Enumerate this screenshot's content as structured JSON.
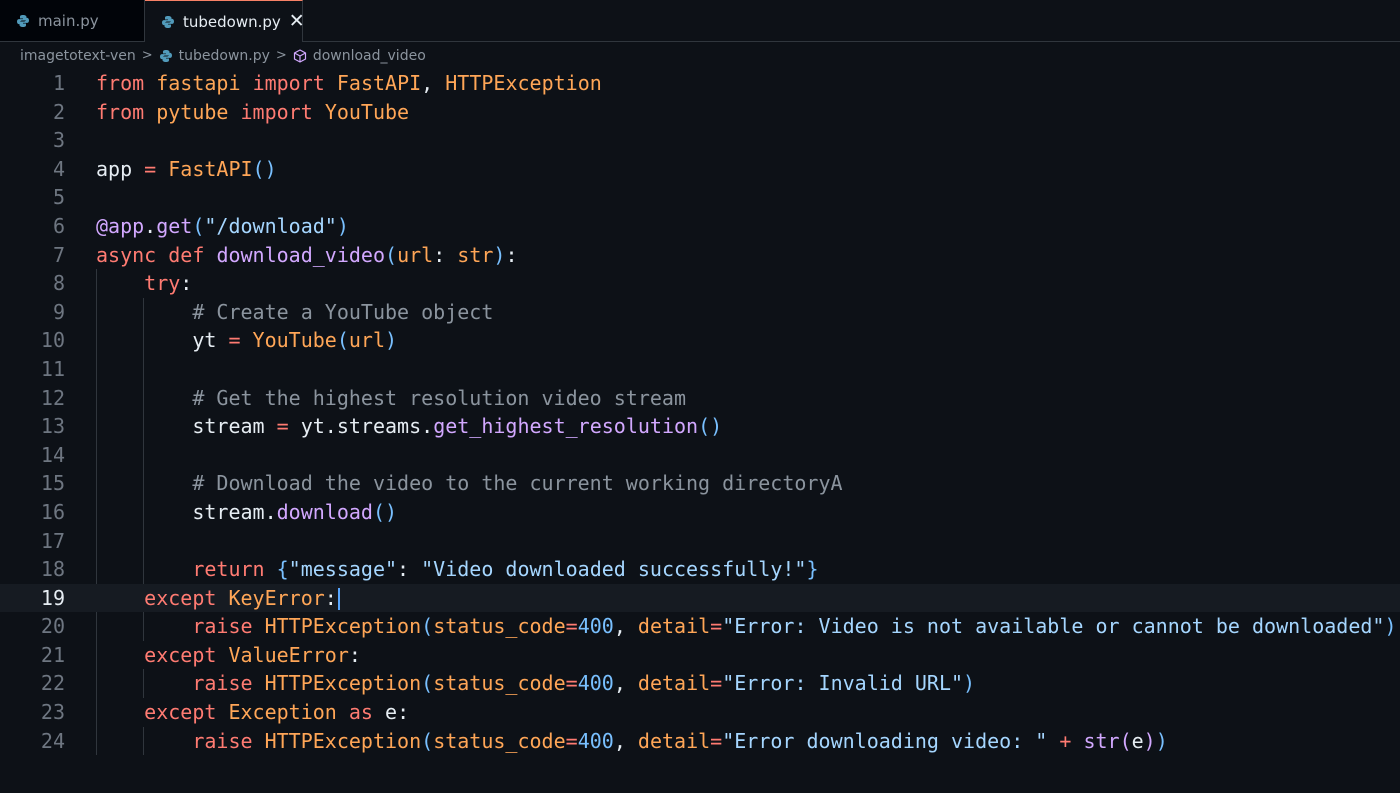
{
  "tabs": [
    {
      "label": "main.py",
      "active": false
    },
    {
      "label": "tubedown.py",
      "active": true,
      "close": "✕"
    }
  ],
  "breadcrumb": {
    "folder": "imagetotext-ven",
    "file": "tubedown.py",
    "symbol": "download_video",
    "separator": ">"
  },
  "editor": {
    "current_line": 19,
    "lines": [
      {
        "n": "1"
      },
      {
        "n": "2"
      },
      {
        "n": "3"
      },
      {
        "n": "4"
      },
      {
        "n": "5"
      },
      {
        "n": "6"
      },
      {
        "n": "7"
      },
      {
        "n": "8"
      },
      {
        "n": "9"
      },
      {
        "n": "10"
      },
      {
        "n": "11"
      },
      {
        "n": "12"
      },
      {
        "n": "13"
      },
      {
        "n": "14"
      },
      {
        "n": "15"
      },
      {
        "n": "16"
      },
      {
        "n": "17"
      },
      {
        "n": "18"
      },
      {
        "n": "19"
      },
      {
        "n": "20"
      },
      {
        "n": "21"
      },
      {
        "n": "22"
      },
      {
        "n": "23"
      },
      {
        "n": "24"
      }
    ],
    "tokens": {
      "from": "from",
      "import": "import",
      "fastapi": "fastapi",
      "FastAPI": "FastAPI",
      "comma": ",",
      "space": " ",
      "HTTPException": "HTTPException",
      "pytube": "pytube",
      "YouTube": "YouTube",
      "app": "app",
      "eq": " = ",
      "lpar": "(",
      "rpar": ")",
      "at_app": "@app",
      "dot": ".",
      "get": "get",
      "download_path": "\"/download\"",
      "async": "async",
      "def": "def",
      "download_video": "download_video",
      "url": "url",
      "colon": ":",
      "str": "str",
      "try": "try",
      "c1": "# Create a YouTube object",
      "yt": "yt",
      "c2": "# Get the highest resolution video stream",
      "stream": "stream",
      "streams": "streams",
      "get_highest_resolution": "get_highest_resolution",
      "c3": "# Download the video to the current working directoryA",
      "download": "download",
      "return": "return",
      "lbrace": "{",
      "rbrace": "}",
      "message_key": "\"message\"",
      "message_val": "\"Video downloaded successfully!\"",
      "except": "except",
      "KeyError": "KeyError",
      "raise": "raise",
      "status_code": "status_code",
      "eq2": "=",
      "n400": "400",
      "detail": "detail",
      "err1": "\"Error: Video is not available or cannot be downloaded\"",
      "ValueError": "ValueError",
      "err2": "\"Error: Invalid URL\"",
      "Exception": "Exception",
      "as": "as",
      "e": "e",
      "err3": "\"Error downloading video: \"",
      "plus": " + "
    }
  },
  "colors": {
    "background": "#0d1117",
    "keyword": "#ff7b72",
    "class": "#ffa657",
    "function": "#d2a8ff",
    "string": "#a5d6ff",
    "number": "#79c0ff",
    "comment": "#8b949e"
  }
}
